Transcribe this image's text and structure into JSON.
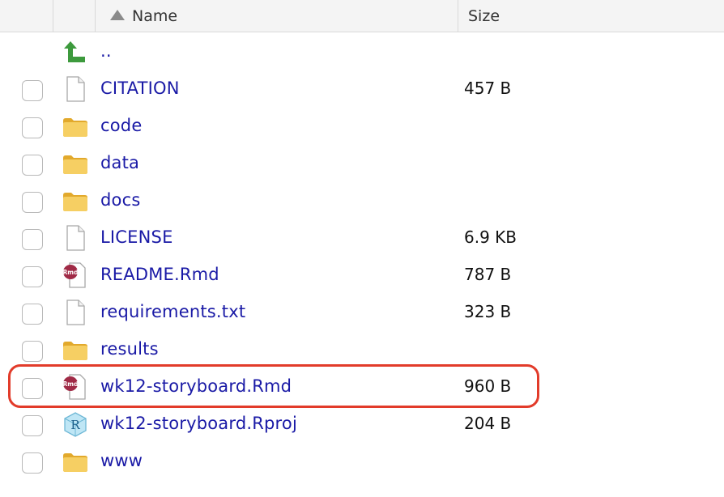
{
  "header": {
    "name_label": "Name",
    "size_label": "Size",
    "sort_icon": "sort-ascending-icon"
  },
  "files": [
    {
      "name": "..",
      "size": "",
      "type": "parent",
      "icon": "up-arrow-icon",
      "checkbox": false
    },
    {
      "name": "CITATION",
      "size": "457 B",
      "type": "file",
      "icon": "file-icon",
      "checkbox": true
    },
    {
      "name": "code",
      "size": "",
      "type": "folder",
      "icon": "folder-icon",
      "checkbox": true
    },
    {
      "name": "data",
      "size": "",
      "type": "folder",
      "icon": "folder-icon",
      "checkbox": true
    },
    {
      "name": "docs",
      "size": "",
      "type": "folder",
      "icon": "folder-icon",
      "checkbox": true
    },
    {
      "name": "LICENSE",
      "size": "6.9 KB",
      "type": "file",
      "icon": "file-icon",
      "checkbox": true
    },
    {
      "name": "README.Rmd",
      "size": "787 B",
      "type": "rmd",
      "icon": "rmd-file-icon",
      "checkbox": true
    },
    {
      "name": "requirements.txt",
      "size": "323 B",
      "type": "file",
      "icon": "file-icon",
      "checkbox": true
    },
    {
      "name": "results",
      "size": "",
      "type": "folder",
      "icon": "folder-icon",
      "checkbox": true
    },
    {
      "name": "wk12-storyboard.Rmd",
      "size": "960 B",
      "type": "rmd",
      "icon": "rmd-file-icon",
      "checkbox": true
    },
    {
      "name": "wk12-storyboard.Rproj",
      "size": "204 B",
      "type": "rproj",
      "icon": "rproj-file-icon",
      "checkbox": true
    },
    {
      "name": "www",
      "size": "",
      "type": "folder",
      "icon": "folder-icon",
      "checkbox": true
    }
  ],
  "highlight": {
    "file": "wk12-storyboard.Rmd",
    "color": "#e23b2a"
  },
  "colors": {
    "link": "#1a1aa6",
    "folder": "#f3c24a",
    "header_bg": "#f4f4f4",
    "rmd_badge": "#a02a46",
    "up_arrow": "#3d9a3d"
  }
}
